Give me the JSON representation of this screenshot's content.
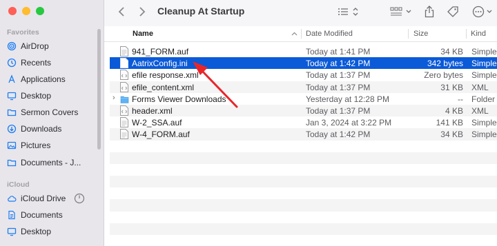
{
  "window": {
    "title": "Cleanup At Startup"
  },
  "sidebar": {
    "favorites_heading": "Favorites",
    "icloud_heading": "iCloud",
    "favorites": [
      {
        "label": "AirDrop",
        "icon": "airdrop-icon"
      },
      {
        "label": "Recents",
        "icon": "clock-icon"
      },
      {
        "label": "Applications",
        "icon": "applications-icon"
      },
      {
        "label": "Desktop",
        "icon": "desktop-icon"
      },
      {
        "label": "Sermon Covers",
        "icon": "folder-icon"
      },
      {
        "label": "Downloads",
        "icon": "download-icon"
      },
      {
        "label": "Pictures",
        "icon": "pictures-icon"
      },
      {
        "label": "Documents - J...",
        "icon": "folder-icon"
      }
    ],
    "icloud": [
      {
        "label": "iCloud Drive",
        "icon": "cloud-icon"
      },
      {
        "label": "Documents",
        "icon": "document-icon"
      },
      {
        "label": "Desktop",
        "icon": "desktop-icon"
      }
    ]
  },
  "columns": {
    "name": "Name",
    "date": "Date Modified",
    "size": "Size",
    "kind": "Kind"
  },
  "files": [
    {
      "name": "941_FORM.auf",
      "date": "Today at 1:41 PM",
      "size": "34 KB",
      "kind": "Simple...",
      "type": "file",
      "selected": false
    },
    {
      "name": "AatrixConfig.ini",
      "date": "Today at 1:42 PM",
      "size": "342 bytes",
      "kind": "Simple...",
      "type": "file",
      "selected": true
    },
    {
      "name": "efile response.xml",
      "date": "Today at 1:37 PM",
      "size": "Zero bytes",
      "kind": "Simple...",
      "type": "xml",
      "selected": false
    },
    {
      "name": "efile_content.xml",
      "date": "Today at 1:37 PM",
      "size": "31 KB",
      "kind": "XML",
      "type": "xml",
      "selected": false
    },
    {
      "name": "Forms Viewer Downloads",
      "date": "Yesterday at 12:28 PM",
      "size": "--",
      "kind": "Folder",
      "type": "folder",
      "selected": false
    },
    {
      "name": "header.xml",
      "date": "Today at 1:37 PM",
      "size": "4 KB",
      "kind": "XML",
      "type": "xml",
      "selected": false
    },
    {
      "name": "W-2_SSA.auf",
      "date": "Jan 3, 2024 at 3:22 PM",
      "size": "141 KB",
      "kind": "Simple...",
      "type": "file",
      "selected": false
    },
    {
      "name": "W-4_FORM.auf",
      "date": "Today at 1:42 PM",
      "size": "34 KB",
      "kind": "Simple...",
      "type": "file",
      "selected": false
    }
  ],
  "colors": {
    "selection": "#0b5ad8",
    "annotation_arrow": "#e8262a",
    "close": "#ff5f57",
    "minimize": "#febc2e",
    "zoom": "#28c840"
  }
}
